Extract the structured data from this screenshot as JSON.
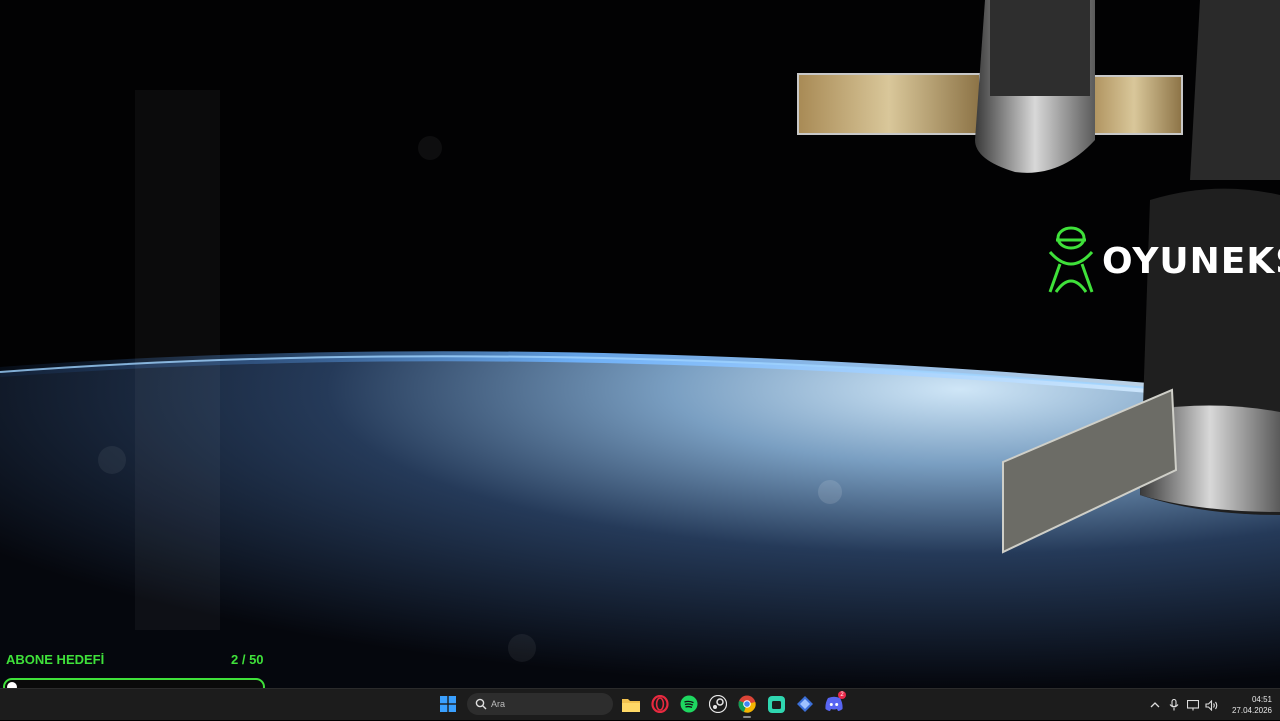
{
  "wallpaper": {
    "description_icon": "space-station-earth-wallpaper"
  },
  "brand": {
    "text": "OYUNEKS",
    "icon": "oyuneks-logo-icon",
    "color": "#3fe13a"
  },
  "subscriber_goal": {
    "label": "ABONE HEDEFİ",
    "current": 2,
    "target": 50,
    "count_text": "2 / 50",
    "progress_fraction": 0.04,
    "accent": "#3fe13a"
  },
  "taskbar": {
    "start_icon": "windows-start-icon",
    "search_placeholder": "Ara",
    "apps": [
      {
        "name": "file-explorer-icon"
      },
      {
        "name": "opera-gx-icon"
      },
      {
        "name": "spotify-icon"
      },
      {
        "name": "steam-icon"
      },
      {
        "name": "chrome-icon"
      },
      {
        "name": "store-app-icon"
      },
      {
        "name": "tool-app-icon"
      },
      {
        "name": "discord-icon",
        "badge": "2"
      }
    ],
    "tray": {
      "icons": [
        "chevron-up-icon",
        "microphone-icon",
        "network-icon",
        "volume-icon"
      ],
      "time": "04:51",
      "date": "27.04.2026"
    }
  }
}
